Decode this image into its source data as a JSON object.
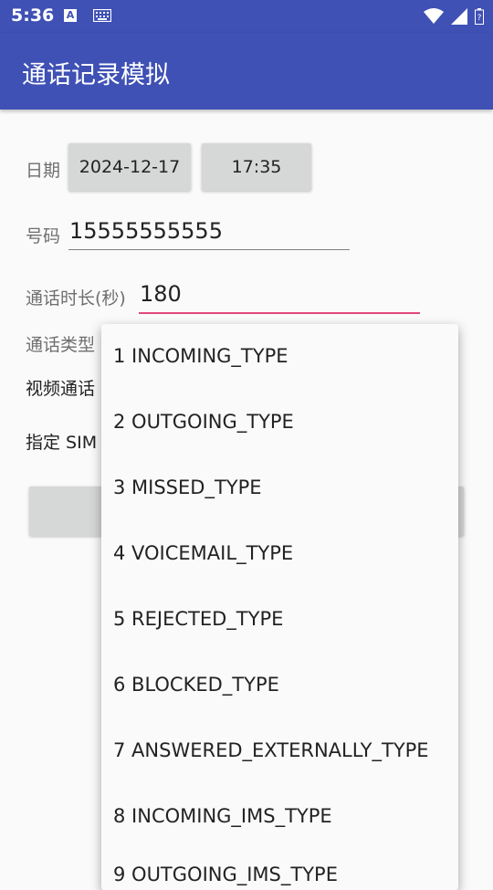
{
  "status": {
    "time": "5:36",
    "a_icon_letter": "A"
  },
  "app": {
    "title": "通话记录模拟"
  },
  "form": {
    "date_label": "日期",
    "date_value": "2024-12-17",
    "time_value": "17:35",
    "number_label": "号码",
    "number_value": "15555555555",
    "duration_label": "通话时长(秒)",
    "duration_value": "180",
    "type_label": "通话类型",
    "video_label": "视频通话",
    "sim_label": "指定 SIM"
  },
  "dropdown": {
    "items": [
      "1 INCOMING_TYPE",
      "2 OUTGOING_TYPE",
      "3 MISSED_TYPE",
      "4 VOICEMAIL_TYPE",
      "5 REJECTED_TYPE",
      "6 BLOCKED_TYPE",
      "7 ANSWERED_EXTERNALLY_TYPE",
      "8 INCOMING_IMS_TYPE",
      "9 OUTGOING_IMS_TYPE"
    ]
  },
  "colors": {
    "primary": "#3f51b5",
    "accent": "#e0477a"
  }
}
